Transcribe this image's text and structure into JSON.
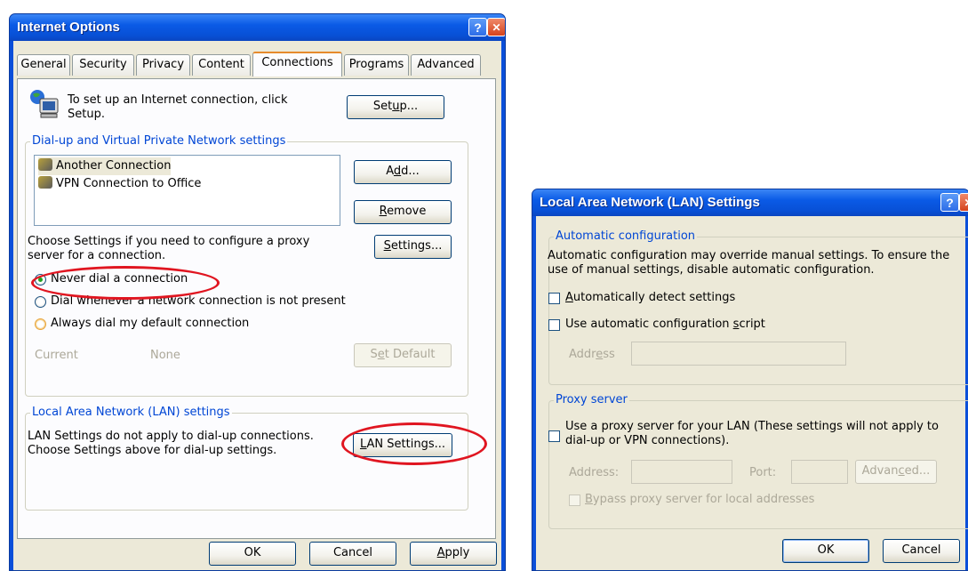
{
  "internet_options": {
    "title": "Internet Options",
    "help_glyph": "?",
    "close_glyph": "✕",
    "tabs": [
      "General",
      "Security",
      "Privacy",
      "Content",
      "Connections",
      "Programs",
      "Advanced"
    ],
    "active_tab": "Connections",
    "setup_text": "To set up an Internet connection, click Setup.",
    "setup_button": "Setup...",
    "dialup_group_label": "Dial-up and Virtual Private Network settings",
    "connections": [
      "Another Connection",
      "VPN Connection to Office"
    ],
    "add_button": "Add...",
    "remove_button": "Remove",
    "proxy_text": "Choose Settings if you need to configure a proxy server for a connection.",
    "settings_button": "Settings...",
    "radio_never": "Never dial a connection",
    "radio_whenever": "Dial whenever a network connection is not present",
    "radio_always": "Always dial my default connection",
    "selected_radio": "Never dial a connection",
    "current_label": "Current",
    "current_value": "None",
    "set_default_button": "Set Default",
    "lan_group_label": "Local Area Network (LAN) settings",
    "lan_text": "LAN Settings do not apply to dial-up connections. Choose Settings above for dial-up settings.",
    "lan_settings_button": "LAN Settings...",
    "ok_button": "OK",
    "cancel_button": "Cancel",
    "apply_button": "Apply"
  },
  "lan_settings": {
    "title": "Local Area Network (LAN) Settings",
    "help_glyph": "?",
    "close_glyph": "✕",
    "auto_group_label": "Automatic configuration",
    "auto_text": "Automatic configuration may override manual settings.  To ensure the use of manual settings, disable automatic configuration.",
    "auto_detect_label": "Automatically detect settings",
    "auto_detect_checked": false,
    "auto_script_label": "Use automatic configuration script",
    "auto_script_checked": false,
    "address_label": "Address",
    "address_value": "",
    "proxy_group_label": "Proxy server",
    "use_proxy_label": "Use a proxy server for your LAN (These settings will not apply to dial-up or VPN connections).",
    "use_proxy_checked": false,
    "proxy_address_label": "Address:",
    "proxy_address_value": "",
    "port_label": "Port:",
    "port_value": "",
    "advanced_button": "Advanced...",
    "bypass_label": "Bypass proxy server for local addresses",
    "bypass_checked": false,
    "ok_button": "OK",
    "cancel_button": "Cancel"
  },
  "colors": {
    "titlebar": "#0a5ae6",
    "dialog_face": "#ece9d8",
    "group_label": "#0046d5",
    "highlight_ring": "#e01520"
  }
}
